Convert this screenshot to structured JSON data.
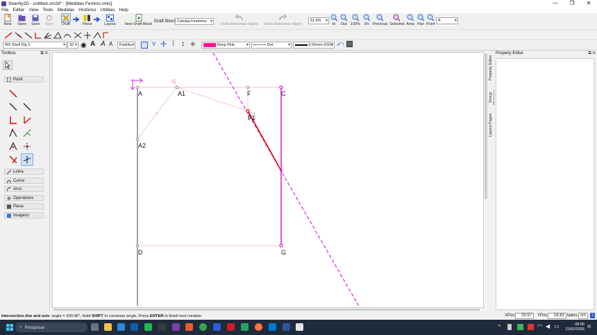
{
  "window": {
    "title": "Seamly2D - untitled.sm2d* - [Medidas Femino.smis]",
    "controls": [
      "—",
      "❐",
      "✕"
    ]
  },
  "menu": [
    "File",
    "Editar",
    "View",
    "Tools",
    "Medidas",
    "Histórico",
    "Utilities",
    "Help"
  ],
  "toolbar": {
    "new": "New",
    "open": "Open",
    "save": "Save",
    "sync": "Sync",
    "draft": "Draft",
    "piece": "Piece",
    "layout": "Layout",
    "new_draft_block": "New Draft Block",
    "draft_block_label": "Draft Block:",
    "draft_block_value": "Camisa Feminino",
    "undo": "Undo Adicionar objeto",
    "redo": "Redo Adicionar objeto",
    "zoom_value": "51,9%",
    "zoom_in": "In",
    "zoom_out": "Out",
    "zoom_100": "100%",
    "zoom_fit": "Fit",
    "previous": "Previous",
    "selected": "Selected",
    "area": "Area",
    "pan": "Pan",
    "point": "Point",
    "font_select": "A"
  },
  "toolbar3": {
    "font": "MS Shell Dlg 2",
    "font_size": "32",
    "label_mode": "Padrão",
    "line_color_name": "Deep Pink",
    "line_color": "#ff1493",
    "line_type": "Dot",
    "line_weight": "0.50mm (ISO)"
  },
  "toolbox": {
    "title": "Toolbox",
    "groups": [
      "Point",
      "Linha",
      "Curva",
      "Arco",
      "Operations",
      "Piece",
      "Imagens"
    ]
  },
  "side_tabs": [
    "Property Editor",
    "Group Manager",
    "Layout Pages"
  ],
  "property_editor": {
    "title": "Property Editor"
  },
  "canvas": {
    "points": [
      "A",
      "A1",
      "F",
      "C",
      "F1",
      "A2",
      "D",
      "G"
    ]
  },
  "status": {
    "message_bold": "Intersection line and axis",
    "message_rest": ": angle = 299.96°, Hold ",
    "shift": "SHIFT",
    "message_mid": " to constrain angle, Press ",
    "enter": "ENTER",
    "message_end": " to finish tool creation",
    "xpos_label": "XPos:",
    "xpos": "25.57",
    "ypos_label": "YPos:",
    "ypos": "16.81",
    "units_label": "lados:",
    "units": "cm"
  },
  "taskbar": {
    "search_placeholder": "Pesquisar",
    "time": "08:56",
    "date": "21/02/2025"
  }
}
